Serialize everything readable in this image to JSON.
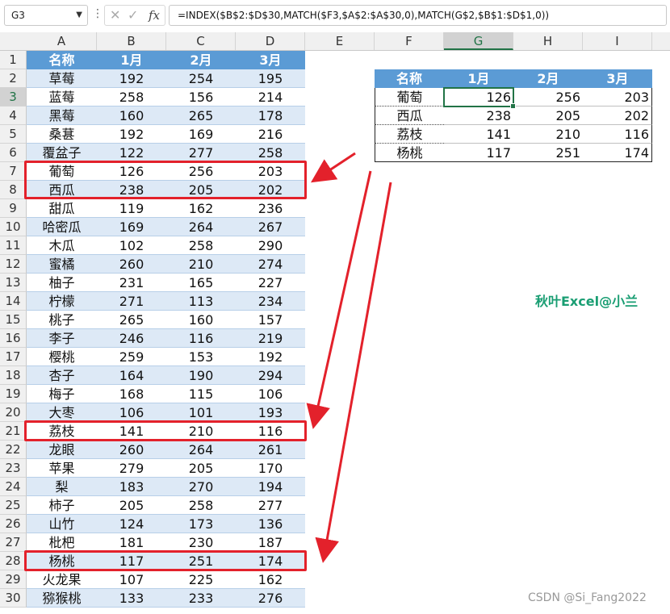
{
  "formula_bar": {
    "name_box": "G3",
    "cancel_icon": "close-icon",
    "enter_icon": "check-icon",
    "fx_label": "fx",
    "formula": "=INDEX($B$2:$D$30,MATCH($F3,$A$2:$A$30,0),MATCH(G$2,$B$1:$D$1,0))"
  },
  "columns": [
    "A",
    "B",
    "C",
    "D",
    "E",
    "F",
    "G",
    "H",
    "I"
  ],
  "selected_column": "G",
  "selected_row": 3,
  "rows": [
    "1",
    "2",
    "3",
    "4",
    "5",
    "6",
    "7",
    "8",
    "9",
    "10",
    "11",
    "12",
    "13",
    "14",
    "15",
    "16",
    "17",
    "18",
    "19",
    "20",
    "21",
    "22",
    "23",
    "24",
    "25",
    "26",
    "27",
    "28",
    "29",
    "30"
  ],
  "source_table": {
    "headers": [
      "名称",
      "1月",
      "2月",
      "3月"
    ],
    "rows": [
      [
        "草莓",
        "192",
        "254",
        "195"
      ],
      [
        "蓝莓",
        "258",
        "156",
        "214"
      ],
      [
        "黑莓",
        "160",
        "265",
        "178"
      ],
      [
        "桑葚",
        "192",
        "169",
        "216"
      ],
      [
        "覆盆子",
        "122",
        "277",
        "258"
      ],
      [
        "葡萄",
        "126",
        "256",
        "203"
      ],
      [
        "西瓜",
        "238",
        "205",
        "202"
      ],
      [
        "甜瓜",
        "119",
        "162",
        "236"
      ],
      [
        "哈密瓜",
        "169",
        "264",
        "267"
      ],
      [
        "木瓜",
        "102",
        "258",
        "290"
      ],
      [
        "蜜橘",
        "260",
        "210",
        "274"
      ],
      [
        "柚子",
        "231",
        "165",
        "227"
      ],
      [
        "柠檬",
        "271",
        "113",
        "234"
      ],
      [
        "桃子",
        "265",
        "160",
        "157"
      ],
      [
        "李子",
        "246",
        "116",
        "219"
      ],
      [
        "樱桃",
        "259",
        "153",
        "192"
      ],
      [
        "杏子",
        "164",
        "190",
        "294"
      ],
      [
        "梅子",
        "168",
        "115",
        "106"
      ],
      [
        "大枣",
        "106",
        "101",
        "193"
      ],
      [
        "荔枝",
        "141",
        "210",
        "116"
      ],
      [
        "龙眼",
        "260",
        "264",
        "261"
      ],
      [
        "苹果",
        "279",
        "205",
        "170"
      ],
      [
        "梨",
        "183",
        "270",
        "194"
      ],
      [
        "柿子",
        "205",
        "258",
        "277"
      ],
      [
        "山竹",
        "124",
        "173",
        "136"
      ],
      [
        "枇杷",
        "181",
        "230",
        "187"
      ],
      [
        "杨桃",
        "117",
        "251",
        "174"
      ],
      [
        "火龙果",
        "107",
        "225",
        "162"
      ],
      [
        "猕猴桃",
        "133",
        "233",
        "276"
      ]
    ]
  },
  "lookup_table": {
    "headers": [
      "名称",
      "1月",
      "2月",
      "3月"
    ],
    "rows": [
      [
        "葡萄",
        "126",
        "256",
        "203"
      ],
      [
        "西瓜",
        "238",
        "205",
        "202"
      ],
      [
        "荔枝",
        "141",
        "210",
        "116"
      ],
      [
        "杨桃",
        "117",
        "251",
        "174"
      ]
    ]
  },
  "watermark": "秋叶Excel@小兰",
  "credit": "CSDN @Si_Fang2022",
  "colors": {
    "header_blue": "#5b9bd5",
    "band_blue": "#dde9f6",
    "highlight_red": "#e3212b",
    "excel_green": "#217346",
    "watermark_green": "#1a9e73"
  }
}
